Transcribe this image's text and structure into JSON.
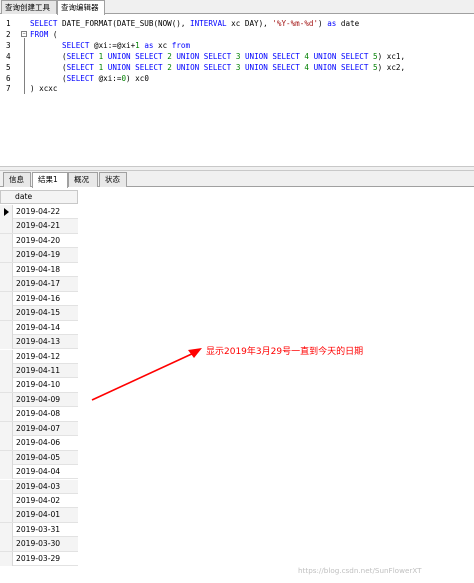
{
  "top_tabs": [
    "查询创建工具",
    "查询编辑器"
  ],
  "editor": {
    "lines": [
      {
        "n": "1",
        "fold": false,
        "html": "<span class=\"kw\">SELECT</span> DATE_FORMAT(DATE_SUB(NOW(), <span class=\"kw\">INTERVAL</span> xc DAY), <span class=\"str\">'%Y-%m-%d'</span>) <span class=\"kw\">as</span> date"
      },
      {
        "n": "2",
        "fold": true,
        "html": "<span class=\"kw\">FROM</span> ("
      },
      {
        "n": "3",
        "fold": false,
        "html": "       <span class=\"kw\">SELECT</span> @xi:=@xi+<span class=\"num\">1</span> <span class=\"kw\">as</span> xc <span class=\"kw\">from</span>"
      },
      {
        "n": "4",
        "fold": false,
        "html": "       (<span class=\"kw\">SELECT</span> <span class=\"num\">1</span> <span class=\"kw\">UNION SELECT</span> <span class=\"num\">2</span> <span class=\"kw\">UNION SELECT</span> <span class=\"num\">3</span> <span class=\"kw\">UNION SELECT</span> <span class=\"num\">4</span> <span class=\"kw\">UNION SELECT</span> <span class=\"num\">5</span>) xc1,"
      },
      {
        "n": "5",
        "fold": false,
        "html": "       (<span class=\"kw\">SELECT</span> <span class=\"num\">1</span> <span class=\"kw\">UNION SELECT</span> <span class=\"num\">2</span> <span class=\"kw\">UNION SELECT</span> <span class=\"num\">3</span> <span class=\"kw\">UNION SELECT</span> <span class=\"num\">4</span> <span class=\"kw\">UNION SELECT</span> <span class=\"num\">5</span>) xc2,"
      },
      {
        "n": "6",
        "fold": false,
        "html": "       (<span class=\"kw\">SELECT</span> @xi:=<span class=\"num\">0</span>) xc0"
      },
      {
        "n": "7",
        "fold": false,
        "html": ") xcxc"
      }
    ]
  },
  "result_tabs": [
    "信息",
    "结果1",
    "概况",
    "状态"
  ],
  "grid": {
    "column": "date",
    "rows": [
      "2019-04-22",
      "2019-04-21",
      "2019-04-20",
      "2019-04-19",
      "2019-04-18",
      "2019-04-17",
      "2019-04-16",
      "2019-04-15",
      "2019-04-14",
      "2019-04-13",
      "2019-04-12",
      "2019-04-11",
      "2019-04-10",
      "2019-04-09",
      "2019-04-08",
      "2019-04-07",
      "2019-04-06",
      "2019-04-05",
      "2019-04-04",
      "2019-04-03",
      "2019-04-02",
      "2019-04-01",
      "2019-03-31",
      "2019-03-30",
      "2019-03-29"
    ]
  },
  "annotation": {
    "text": "显示2019年3月29号一直到今天的日期",
    "color": "#ff0000"
  },
  "watermark": "https://blog.csdn.net/SunFlowerXT"
}
